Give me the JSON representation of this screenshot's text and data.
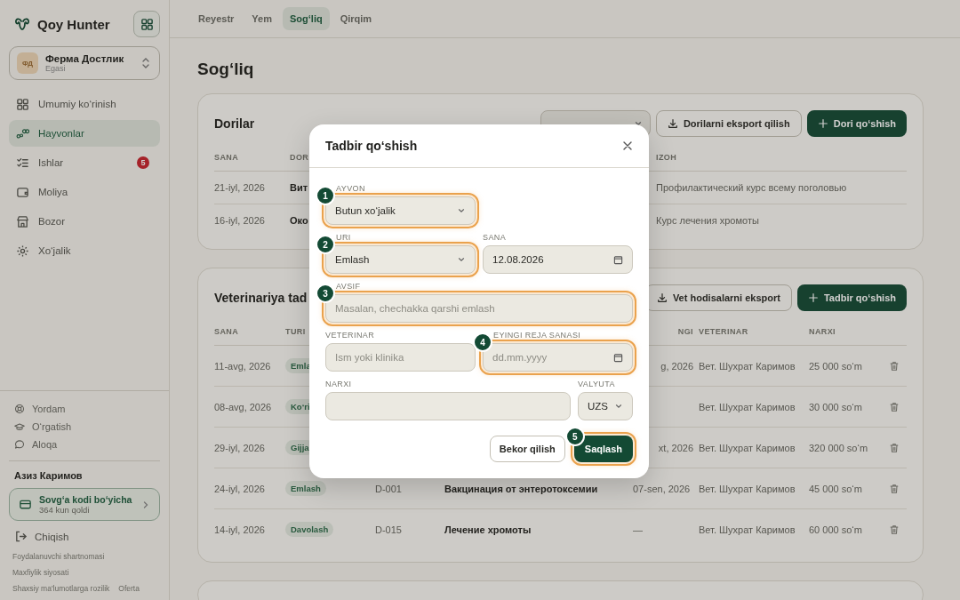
{
  "sidebar": {
    "brand": "Qoy Hunter",
    "farm": {
      "initials": "ФД",
      "name": "Ферма Достлик",
      "role": "Egasi"
    },
    "nav": [
      {
        "label": "Umumiy ko‘rinish",
        "kind": "grid",
        "selected": false
      },
      {
        "label": "Hayvonlar",
        "kind": "sheep",
        "selected": true
      },
      {
        "label": "Ishlar",
        "kind": "tasks",
        "selected": false,
        "badge": "5"
      },
      {
        "label": "Moliya",
        "kind": "wallet",
        "selected": false
      },
      {
        "label": "Bozor",
        "kind": "store",
        "selected": false
      },
      {
        "label": "Xo‘jalik",
        "kind": "gear",
        "selected": false
      }
    ],
    "help": [
      {
        "label": "Yordam",
        "kind": "lifebuoy"
      },
      {
        "label": "O‘rgatish",
        "kind": "cap"
      },
      {
        "label": "Aloqa",
        "kind": "chat"
      }
    ],
    "user": "Азиз Каримов",
    "promo": {
      "title": "Sovg‘a kodi bo‘yicha",
      "subtitle": "364 kun qoldi"
    },
    "logout": "Chiqish",
    "footer_links": [
      "Foydalanuvchi shartnomasi",
      "Maxfiylik siyosati",
      "Shaxsiy ma'lumotlarga rozilik",
      "Oferta"
    ]
  },
  "tabs": [
    {
      "label": "Reyestr",
      "selected": false
    },
    {
      "label": "Yem",
      "selected": false
    },
    {
      "label": "Sog‘liq",
      "selected": true
    },
    {
      "label": "Qirqim",
      "selected": false
    }
  ],
  "page_title": "Sog‘liq",
  "medicines": {
    "title": "Dorilar",
    "export_button": "Dorilarni eksport qilish",
    "add_button": "Dori qo‘shish",
    "columns": {
      "column_1": "SANA",
      "column_2": "DOR",
      "column_3": "IZOH"
    },
    "rows": [
      {
        "column_1": "21-iyl, 2026",
        "column_2": "Вит",
        "column_3": "Профилактический курс всему поголовью"
      },
      {
        "column_1": "16-iyl, 2026",
        "column_2": "Око",
        "column_3": "Курс лечения хромоты"
      }
    ]
  },
  "vet_events": {
    "title": "Veterinariya tad",
    "export_button": "Vet hodisalarni eksport",
    "add_button": "Tadbir qo‘shish",
    "columns": {
      "column_1": "SANA",
      "column_2": "TURI",
      "column_5": "NGI",
      "column_6": "VETERINAR",
      "column_7": "NARXI"
    },
    "rows": [
      {
        "column_1": "11-avg, 2026",
        "column_2": "Emla",
        "column_5": "g, 2026",
        "column_6": "Вет. Шухрат Каримов",
        "column_7": "25 000 so‘m"
      },
      {
        "column_1": "08-avg, 2026",
        "column_2": "Ko‘ri",
        "column_6": "Вет. Шухрат Каримов",
        "column_7": "30 000 so‘m"
      },
      {
        "column_1": "29-iyl, 2026",
        "column_2": "Gijja",
        "column_5": "xt, 2026",
        "column_6": "Вет. Шухрат Каримов",
        "column_7": "320 000 so‘m"
      },
      {
        "column_1": "24-iyl, 2026",
        "column_2": "Emlash",
        "column_3": "D-001",
        "column_4": "Вакцинация от энтеротоксемии",
        "column_5": "07-sen, 2026",
        "column_6": "Вет. Шухрат Каримов",
        "column_7": "45 000 so‘m"
      },
      {
        "column_1": "14-iyl, 2026",
        "column_2": "Davolash",
        "column_3": "D-015",
        "column_4": "Лечение хромоты",
        "column_5": "—",
        "column_6": "Вет. Шухрат Каримов",
        "column_7": "60 000 so‘m"
      }
    ]
  },
  "dialog": {
    "title": "Tadbir qo‘shish",
    "rows": [
      [
        {
          "label": "AYVON",
          "kind": "select",
          "value": "Butun xo‘jalik",
          "highlighted": true,
          "step": "1"
        }
      ],
      [
        {
          "label": "URI",
          "kind": "select",
          "value": "Emlash",
          "highlighted": true,
          "step": "2"
        },
        {
          "label": "SANA",
          "kind": "date",
          "value": "12.08.2026",
          "highlighted": false
        }
      ],
      [
        {
          "label": "AVSIF",
          "kind": "text",
          "placeholder": "Masalan, chechakka qarshi emlash",
          "highlighted": true,
          "step": "3"
        }
      ],
      [
        {
          "label": "VETERINAR",
          "kind": "text",
          "placeholder": "Ism yoki klinika",
          "highlighted": false
        },
        {
          "label": "EYINGI REJA SANASI",
          "kind": "date",
          "placeholder": "dd.mm.yyyy",
          "highlighted": true,
          "step": "4"
        }
      ],
      [
        {
          "label": "NARXI",
          "kind": "text",
          "highlighted": false
        },
        {
          "label": "VALYUTA",
          "kind": "select",
          "value": "UZS",
          "highlighted": false
        }
      ]
    ],
    "buttons": [
      {
        "label": "Bekor qilish",
        "kind": "secondary",
        "highlighted": false
      },
      {
        "label": "Saqlash",
        "kind": "primary",
        "highlighted": true,
        "step": "5"
      }
    ]
  }
}
